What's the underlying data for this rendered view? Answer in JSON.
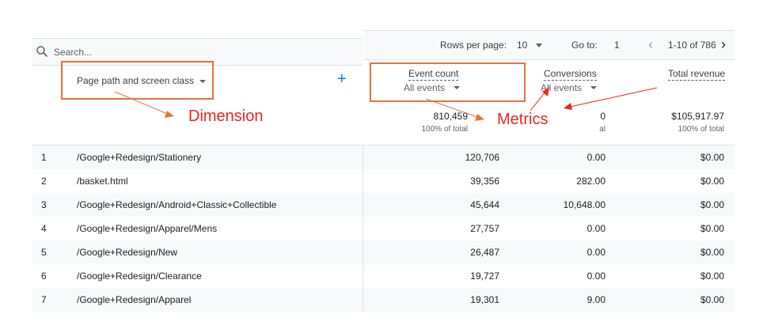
{
  "search": {
    "placeholder": "Search..."
  },
  "dimension": {
    "label": "Page path and screen class"
  },
  "annotations": {
    "dimension": "Dimension",
    "metrics": "Metrics",
    "color": "#e8291c",
    "box_color": "#e8733a"
  },
  "pagination": {
    "rows_label": "Rows per page:",
    "rows_value": "10",
    "goto_label": "Go to:",
    "goto_value": "1",
    "range": "1-10 of 786"
  },
  "columns": [
    {
      "title": "Event count",
      "filter": "All events",
      "total": "810,459",
      "total_sub": "100% of total"
    },
    {
      "title": "Conversions",
      "filter": "All events",
      "total": "0",
      "total_sub": "al"
    },
    {
      "title": "Total revenue",
      "filter": "",
      "total": "$105,917.97",
      "total_sub": "100% of total"
    }
  ],
  "rows": [
    {
      "n": "1",
      "path": "/Google+Redesign/Stationery",
      "events": "120,706",
      "conv": "0.00",
      "rev": "$0.00"
    },
    {
      "n": "2",
      "path": "/basket.html",
      "events": "39,356",
      "conv": "282.00",
      "rev": "$0.00"
    },
    {
      "n": "3",
      "path": "/Google+Redesign/Android+Classic+Collectible",
      "events": "45,644",
      "conv": "10,648.00",
      "rev": "$0.00"
    },
    {
      "n": "4",
      "path": "/Google+Redesign/Apparel/Mens",
      "events": "27,757",
      "conv": "0.00",
      "rev": "$0.00"
    },
    {
      "n": "5",
      "path": "/Google+Redesign/New",
      "events": "26,487",
      "conv": "0.00",
      "rev": "$0.00"
    },
    {
      "n": "6",
      "path": "/Google+Redesign/Clearance",
      "events": "19,727",
      "conv": "0.00",
      "rev": "$0.00"
    },
    {
      "n": "7",
      "path": "/Google+Redesign/Apparel",
      "events": "19,301",
      "conv": "9.00",
      "rev": "$0.00"
    }
  ]
}
